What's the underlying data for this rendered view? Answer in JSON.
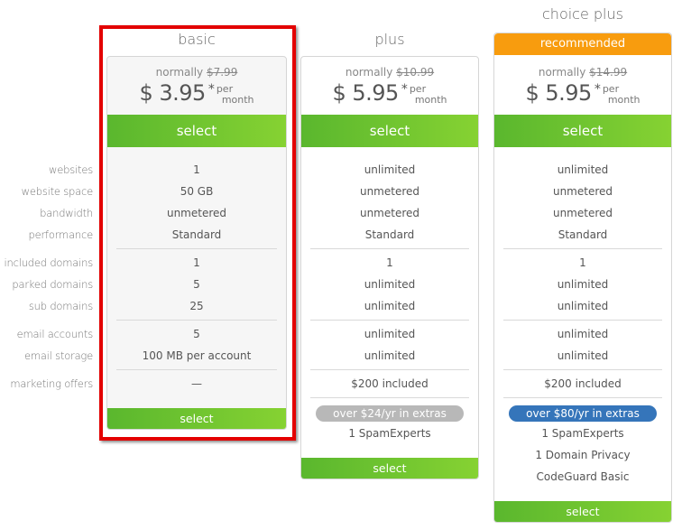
{
  "row_labels": [
    "websites",
    "website space",
    "bandwidth",
    "performance",
    "included domains",
    "parked domains",
    "sub domains",
    "email accounts",
    "email storage",
    "marketing offers"
  ],
  "plans": [
    {
      "name": "basic",
      "normally_label": "normally",
      "normal_price": "$7.99",
      "price": "$ 3.95",
      "asterisk": "*",
      "per": "per",
      "month": "month",
      "select_label": "select",
      "values": [
        "1",
        "50 GB",
        "unmetered",
        "Standard",
        "1",
        "5",
        "25",
        "5",
        "100 MB per account",
        "—"
      ],
      "highlighted": true
    },
    {
      "name": "plus",
      "normally_label": "normally",
      "normal_price": "$10.99",
      "price": "$ 5.95",
      "asterisk": "*",
      "per": "per",
      "month": "month",
      "select_label": "select",
      "values": [
        "unlimited",
        "unmetered",
        "unmetered",
        "Standard",
        "1",
        "unlimited",
        "unlimited",
        "unlimited",
        "unlimited",
        "$200 included"
      ],
      "extras_badge": "over $24/yr in extras",
      "extras": [
        "1 SpamExperts"
      ]
    },
    {
      "name": "choice plus",
      "ribbon": "recommended",
      "normally_label": "normally",
      "normal_price": "$14.99",
      "price": "$ 5.95",
      "asterisk": "*",
      "per": "per",
      "month": "month",
      "select_label": "select",
      "values": [
        "unlimited",
        "unmetered",
        "unmetered",
        "Standard",
        "1",
        "unlimited",
        "unlimited",
        "unlimited",
        "unlimited",
        "$200 included"
      ],
      "extras_badge": "over $80/yr in extras",
      "extras": [
        "1 SpamExperts",
        "1 Domain Privacy",
        "CodeGuard Basic"
      ]
    }
  ],
  "colors": {
    "select_green": "#6cc331",
    "recommended_orange": "#f89c0e",
    "extras_blue": "#3575ba",
    "extras_gray": "#b8b8b8",
    "highlight_red": "#e30000"
  }
}
